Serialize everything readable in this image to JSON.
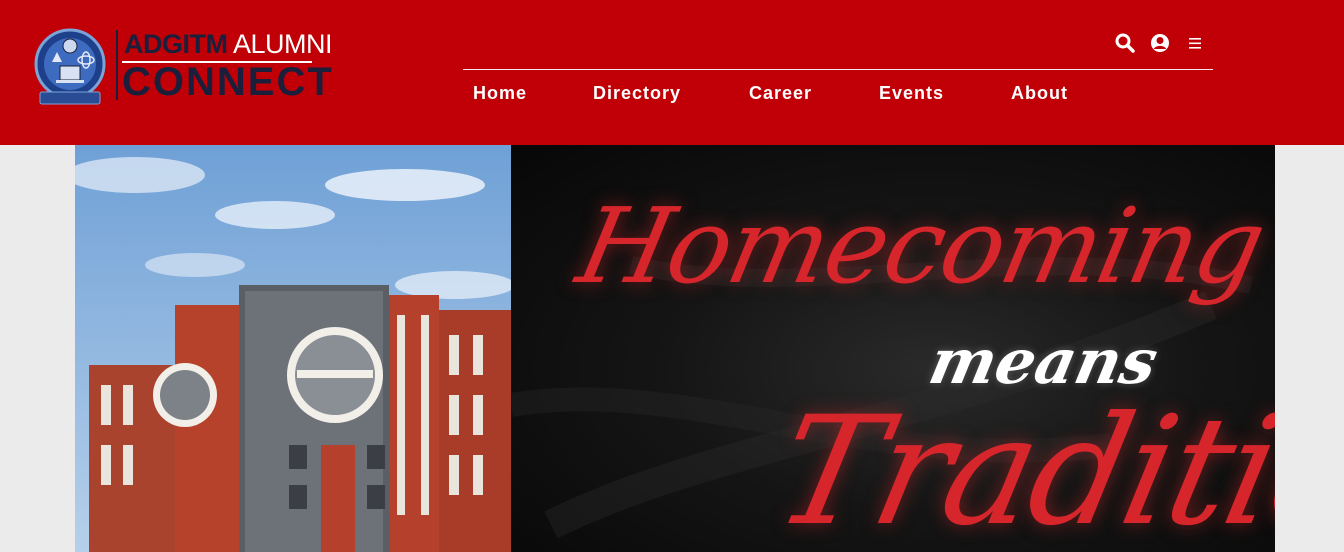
{
  "header": {
    "logo": {
      "brand_top_bold": "ADGITM",
      "brand_top_light": "ALUMNI",
      "brand_bottom": "CONNECT",
      "emblem_motto": "सत्यं शिवं सुंदरम्"
    },
    "icons": [
      "search-icon",
      "user-circle-icon",
      "menu-icon"
    ],
    "nav": [
      {
        "label": "Home"
      },
      {
        "label": "Directory"
      },
      {
        "label": "Career"
      },
      {
        "label": "Events"
      },
      {
        "label": "About"
      }
    ]
  },
  "banner": {
    "poster": {
      "line1": "Homecoming",
      "line2": "means",
      "line3": "Tradition"
    }
  },
  "colors": {
    "header_bg": "#c00006",
    "brand_navy": "#1b1f3b",
    "script_red": "#d7252c",
    "page_bg": "#ebebeb"
  }
}
